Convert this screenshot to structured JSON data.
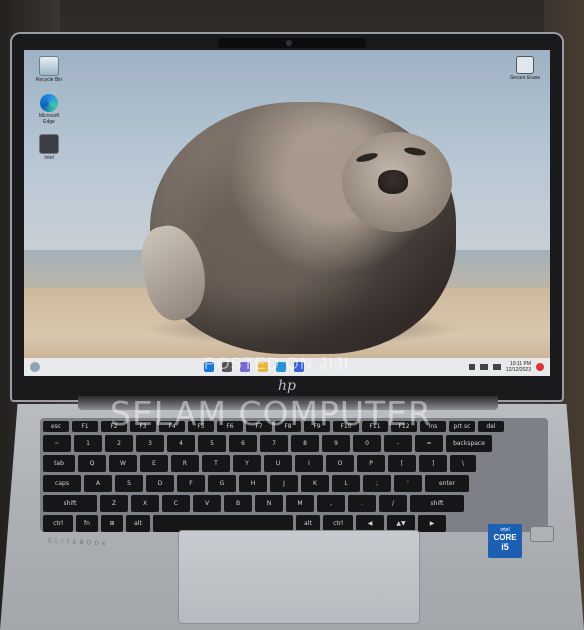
{
  "desktop": {
    "icons": [
      {
        "label": "Recycle Bin",
        "icon": "recycle-bin-icon"
      },
      {
        "label": "Microsoft Edge",
        "icon": "edge-icon"
      },
      {
        "label": "Intel",
        "icon": "app-icon"
      }
    ],
    "right_icon": {
      "label": "Secure Erase",
      "icon": "shield-icon"
    }
  },
  "taskbar": {
    "clock": "10:11 PM",
    "date": "12/12/2023"
  },
  "laptop": {
    "logo": "hp",
    "model_text": "ELITEBOOK",
    "badge_brand": "intel",
    "badge_line1": "CORE",
    "badge_line2": "i5"
  },
  "keyboard": {
    "row1": [
      "esc",
      "F1",
      "F2",
      "F3",
      "F4",
      "F5",
      "F6",
      "F7",
      "F8",
      "F9",
      "F10",
      "F11",
      "F12",
      "ins",
      "prt sc",
      "del"
    ],
    "row2": [
      "~",
      "1",
      "2",
      "3",
      "4",
      "5",
      "6",
      "7",
      "8",
      "9",
      "0",
      "-",
      "=",
      "backspace"
    ],
    "row3": [
      "tab",
      "Q",
      "W",
      "E",
      "R",
      "T",
      "Y",
      "U",
      "I",
      "O",
      "P",
      "[",
      "]",
      "\\"
    ],
    "row4": [
      "caps",
      "A",
      "S",
      "D",
      "F",
      "G",
      "H",
      "J",
      "K",
      "L",
      ";",
      "'",
      "enter"
    ],
    "row5": [
      "shift",
      "Z",
      "X",
      "C",
      "V",
      "B",
      "N",
      "M",
      ",",
      ".",
      "/",
      "shift"
    ],
    "row6": [
      "ctrl",
      "fn",
      "⊞",
      "alt",
      "",
      "alt",
      "ctrl",
      "◀",
      "▲▼",
      "▶"
    ]
  },
  "watermarks": {
    "line1": "POSTED ON JIJI",
    "line2": "SELAM COMPUTER"
  }
}
